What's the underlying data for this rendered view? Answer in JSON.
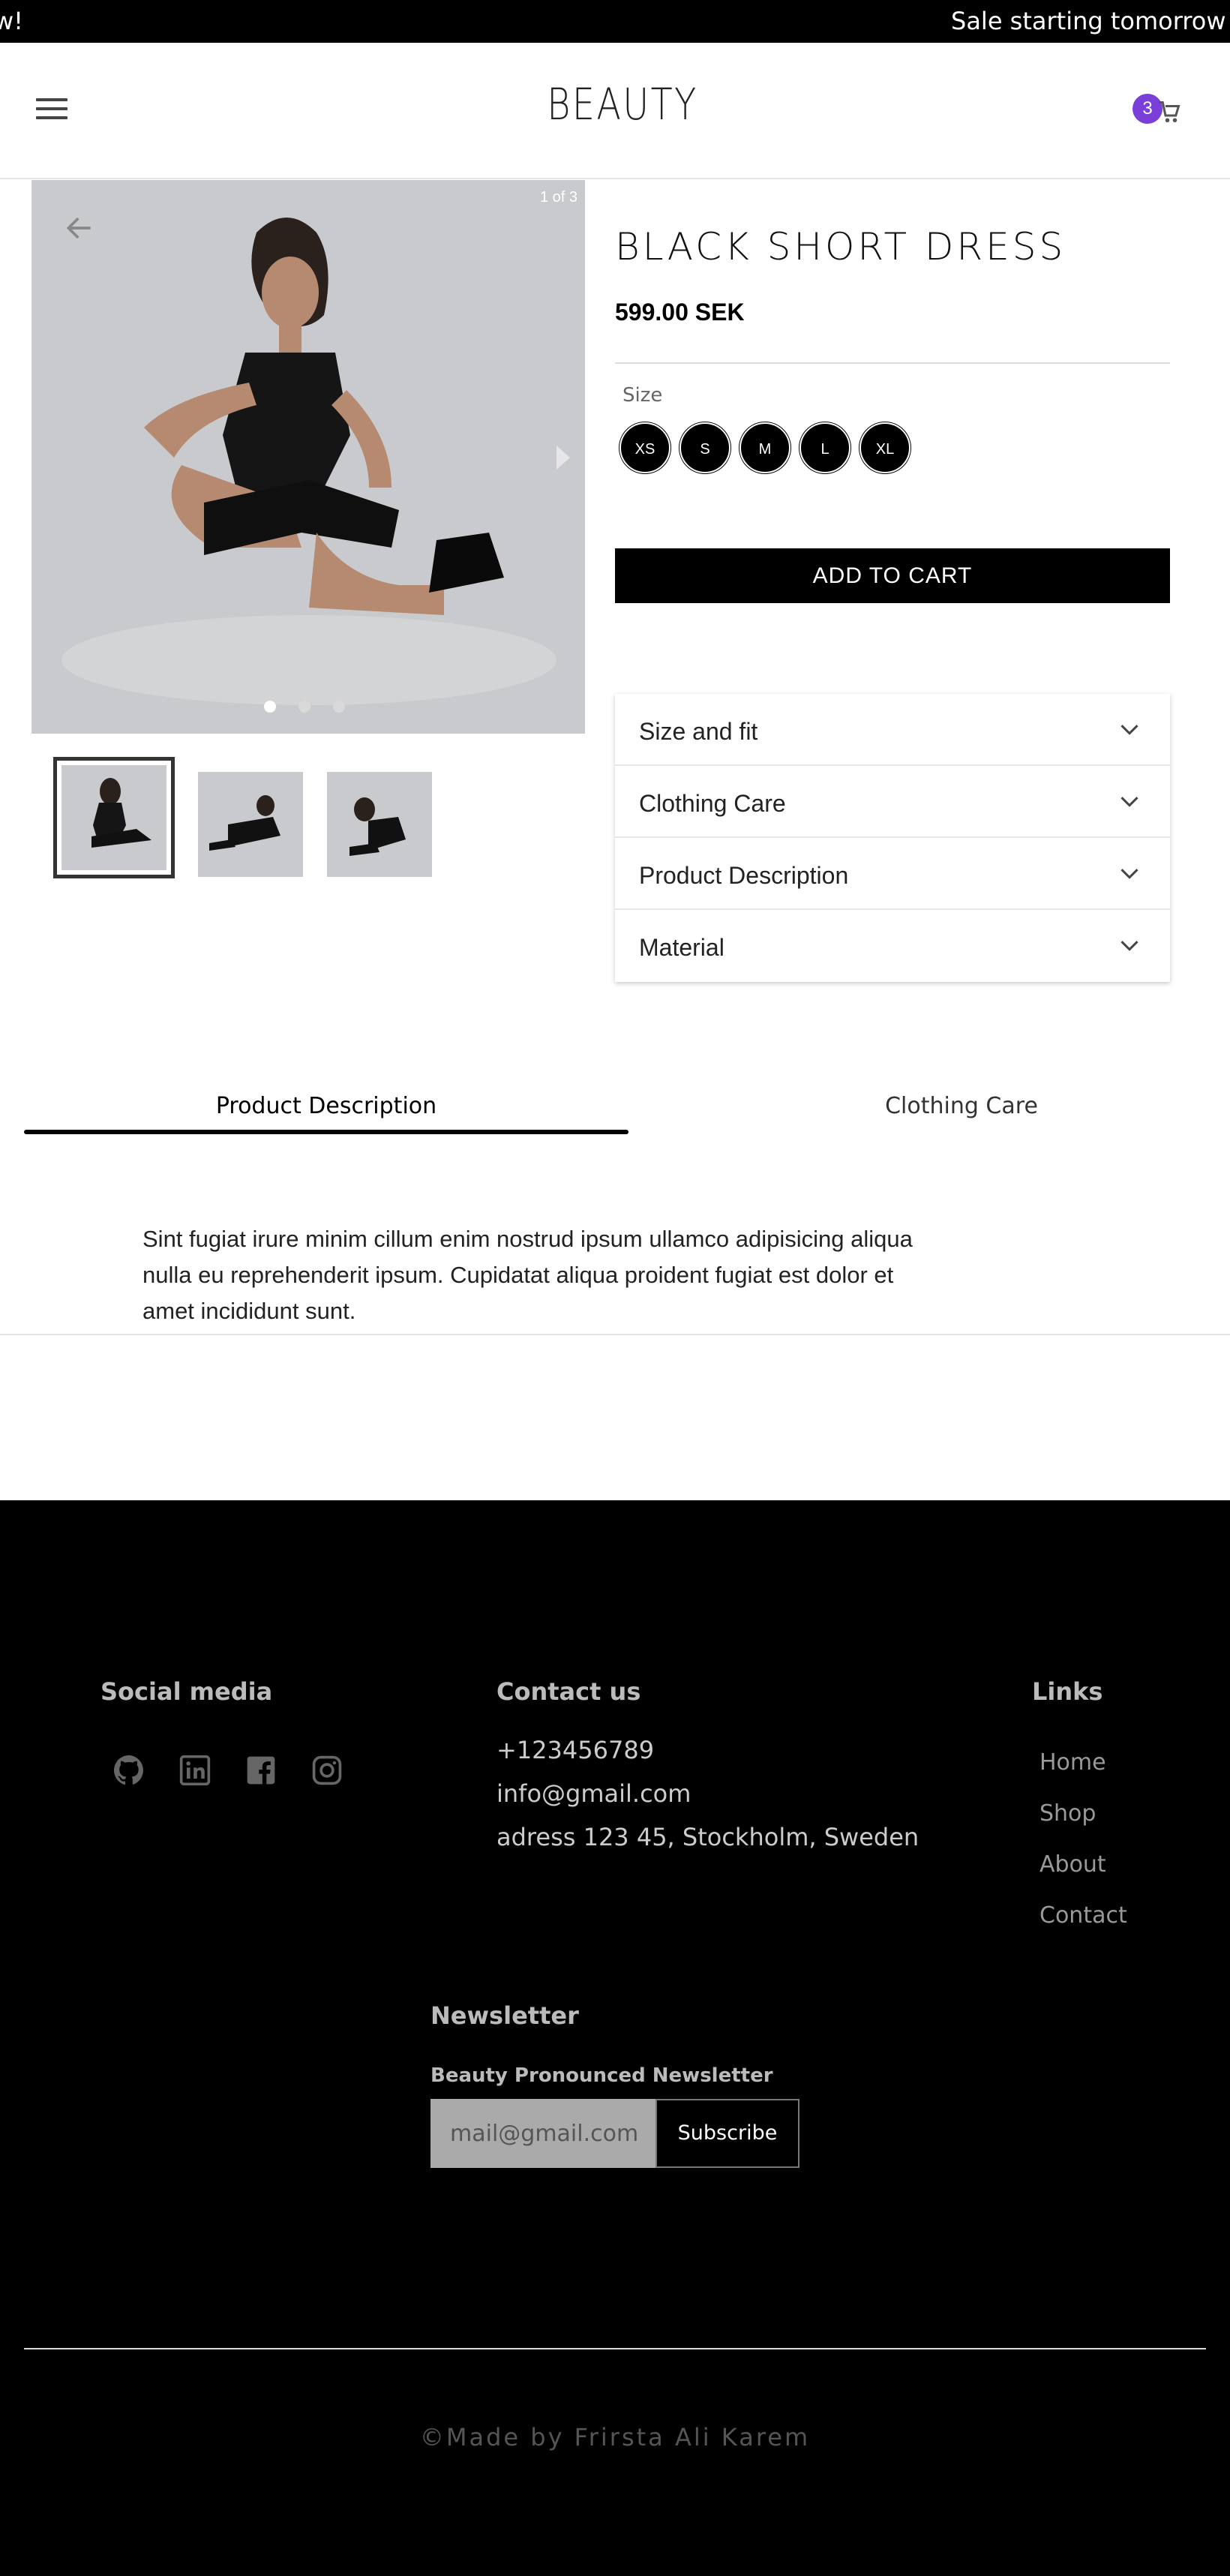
{
  "announcement": {
    "text_left": "w!",
    "text_right": "Sale starting tomorrow"
  },
  "header": {
    "brand": "BEAUTY",
    "cart_count": "3",
    "menu_icon": "hamburger-menu-icon",
    "cart_icon": "shopping-cart-icon"
  },
  "gallery": {
    "counter": "1 of 3",
    "dot_count": 3,
    "active_index": 0
  },
  "product": {
    "title": "BLACK SHORT DRESS",
    "price": "599.00 SEK",
    "size_label": "Size",
    "sizes": [
      "XS",
      "S",
      "M",
      "L",
      "XL"
    ],
    "add_to_cart": "ADD TO CART"
  },
  "accordion": [
    "Size and fit",
    "Clothing Care",
    "Product Description",
    "Material"
  ],
  "tabs": {
    "items": [
      "Product Description",
      "Clothing Care"
    ],
    "active": 0,
    "content": "Sint fugiat irure minim cillum enim nostrud ipsum ullamco adipisicing aliqua nulla eu reprehenderit ipsum. Cupidatat aliqua proident fugiat est dolor et amet incididunt sunt."
  },
  "footer": {
    "social_heading": "Social media",
    "social_icons": [
      "github-icon",
      "linkedin-icon",
      "facebook-icon",
      "instagram-icon"
    ],
    "contact_heading": "Contact us",
    "phone": "+123456789",
    "email": "info@gmail.com",
    "address": "adress 123 45, Stockholm, Sweden",
    "links_heading": "Links",
    "links": [
      "Home",
      "Shop",
      "About",
      "Contact"
    ],
    "newsletter_heading": "Newsletter",
    "newsletter_subheading": "Beauty Pronounced Newsletter",
    "newsletter_placeholder": "mail@gmail.com",
    "subscribe": "Subscribe",
    "copyright": "©Made by Frirsta Ali Karem"
  },
  "colors": {
    "accent_badge": "#7b3fd9",
    "announcement_bg": "#000000",
    "footer_bg": "#000000"
  }
}
